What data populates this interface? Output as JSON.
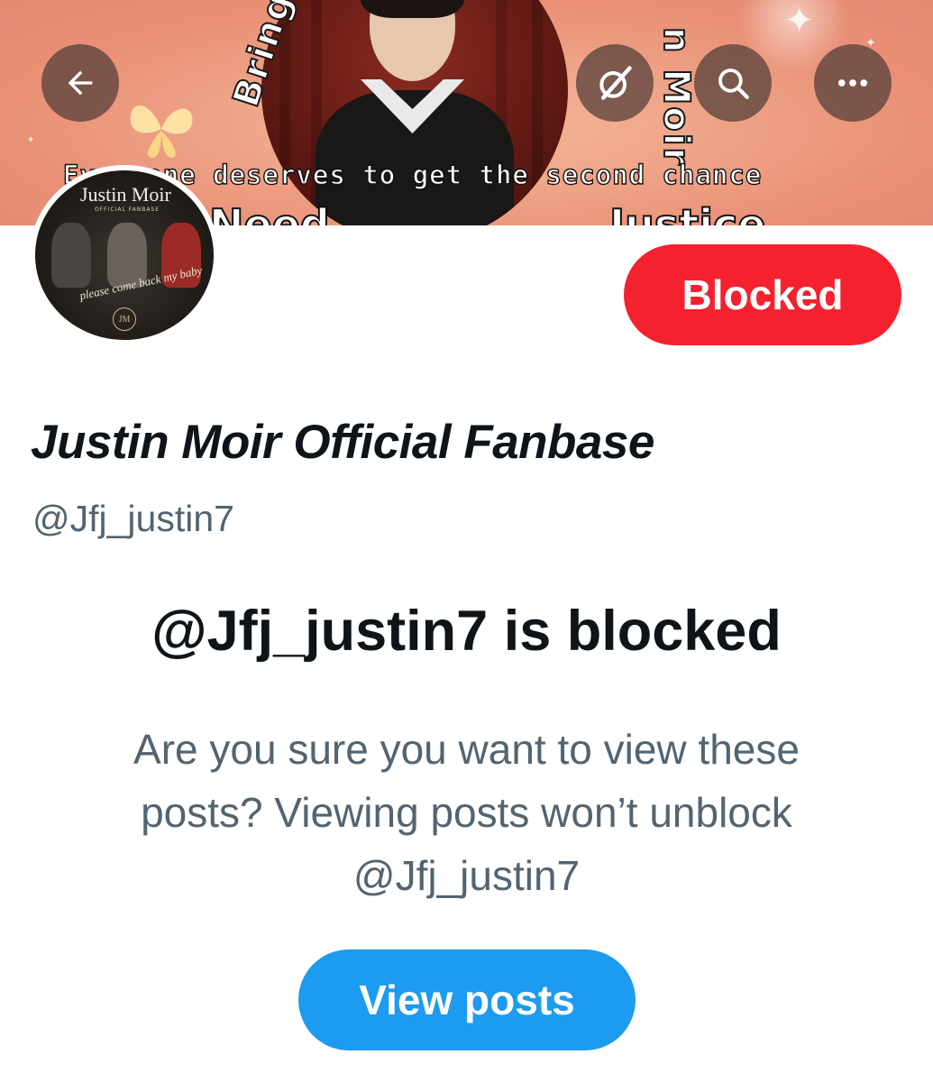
{
  "banner": {
    "tagline": "Everyone deserves to get the second chance",
    "arc_left_text": "Bring",
    "arc_right_text": "n Moir",
    "bottom_left_text": "Need",
    "bottom_right_text": "Justice"
  },
  "nav": {
    "back_icon": "arrow-left-icon",
    "grok_icon": "grok-icon",
    "search_icon": "search-icon",
    "more_icon": "more-icon"
  },
  "avatar": {
    "logo_text": "Justin Moir",
    "logo_sub": "OFFICIAL FANBASE",
    "script_text": "please come back my baby",
    "monogram": "JM"
  },
  "profile": {
    "blocked_button_label": "Blocked",
    "display_name": "Justin Moir Official Fanbase",
    "handle": "@Jfj_justin7"
  },
  "blocked_notice": {
    "title": "@Jfj_justin7 is blocked",
    "line1": "Are you sure you want to view these",
    "line2": "posts? Viewing posts won’t unblock",
    "line3": "@Jfj_justin7",
    "view_posts_label": "View posts"
  },
  "colors": {
    "blocked_red": "#f4212e",
    "twitter_blue": "#1d9bf0",
    "text_primary": "#0f1419",
    "text_secondary": "#536471"
  }
}
